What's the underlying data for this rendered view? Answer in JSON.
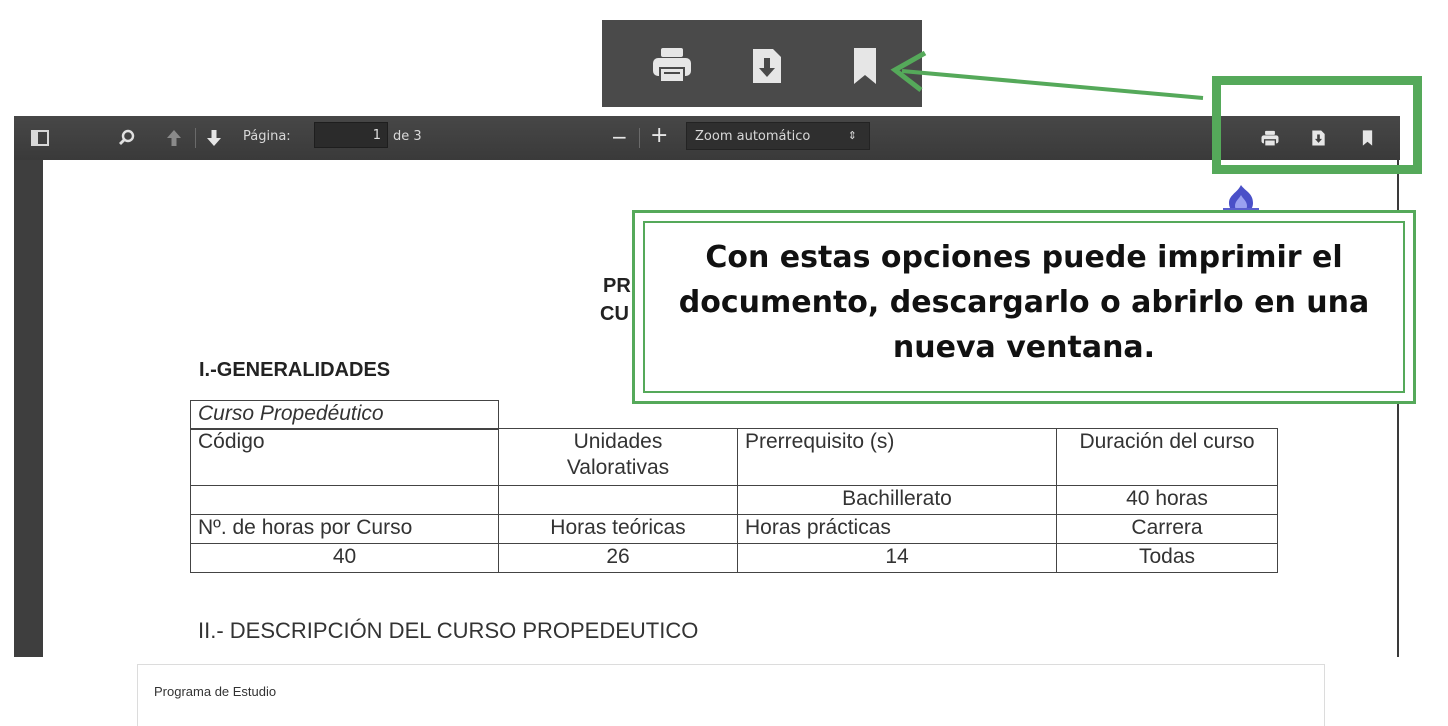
{
  "toolbar": {
    "page_label": "Página:",
    "page_number": "1",
    "page_of": "de 3",
    "zoom_minus": "−",
    "zoom_plus": "+",
    "zoom_value": "Zoom automático",
    "zoom_select_arrow": "⇕"
  },
  "document": {
    "title_fragment_1": "PR",
    "title_fragment_2": "CU",
    "section1": "I.-GENERALIDADES",
    "section2": "II.- DESCRIPCIÓN DEL CURSO PROPEDEUTICO",
    "table_head": "Curso Propedéutico",
    "table_rows": [
      [
        "Código",
        "Unidades Valorativas",
        "Prerrequisito (s)",
        "Duración del curso"
      ],
      [
        "",
        "",
        "Bachillerato",
        "40 horas"
      ],
      [
        "Nº. de horas por Curso",
        "Horas teóricas",
        "Horas prácticas",
        "Carrera"
      ],
      [
        "40",
        "26",
        "14",
        "Todas"
      ]
    ]
  },
  "callout": {
    "text": "Con estas opciones puede imprimir el documento, descargarlo o abrirlo en una nueva ventana."
  },
  "footer": {
    "title": "Programa de Estudio"
  },
  "colors": {
    "annotation_green": "#55a95a",
    "toolbar_bg": "#404040"
  }
}
